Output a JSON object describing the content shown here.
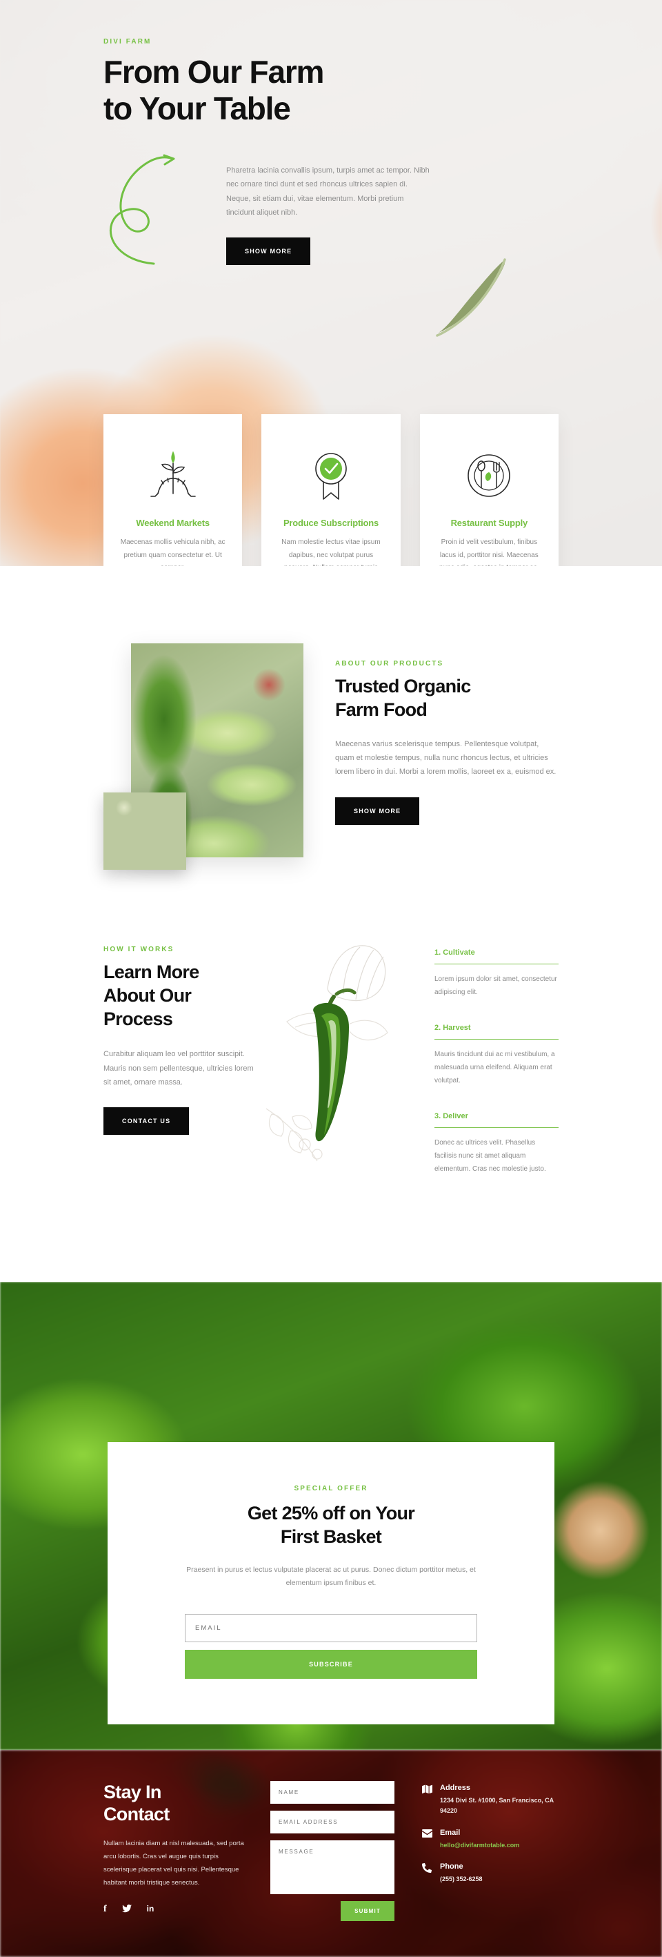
{
  "hero": {
    "eyebrow": "DIVI FARM",
    "title_line1": "From Our Farm",
    "title_line2": "to Your Table",
    "paragraph": "Pharetra lacinia convallis ipsum, turpis amet ac tempor. Nibh nec ornare tinci dunt et sed rhoncus ultrices sapien di. Neque, sit etiam dui, vitae elementum. Morbi pretium tincidunt aliquet nibh.",
    "cta_label": "SHOW MORE"
  },
  "cards": [
    {
      "icon": "seedling-icon",
      "title": "Weekend Markets",
      "text": "Maecenas mollis vehicula nibh, ac pretium quam consectetur et. Ut semper."
    },
    {
      "icon": "award-badge-icon",
      "title": "Produce Subscriptions",
      "text": "Nam molestie lectus vitae ipsum dapibus, nec volutpat purus posuere. Nullam semper turpis"
    },
    {
      "icon": "plate-cutlery-icon",
      "title": "Restaurant Supply",
      "text": "Proin id velit vestibulum, finibus lacus id, porttitor nisi. Maecenas nunc odio, egestas in tempor ac."
    }
  ],
  "about": {
    "eyebrow": "ABOUT OUR PRODUCTS",
    "title_line1": "Trusted Organic",
    "title_line2": "Farm Food",
    "paragraph": "Maecenas varius scelerisque tempus. Pellentesque volutpat, quam et molestie tempus, nulla nunc rhoncus lectus, et ultricies lorem libero in dui. Morbi a lorem mollis, laoreet ex a, euismod ex.",
    "cta_label": "SHOW MORE"
  },
  "process": {
    "eyebrow": "HOW IT WORKS",
    "title_line1": "Learn More",
    "title_line2": "About Our",
    "title_line3": "Process",
    "paragraph": "Curabitur aliquam leo vel porttitor suscipit. Mauris non sem pellentesque, ultricies lorem sit amet, ornare massa.",
    "cta_label": "CONTACT US",
    "steps": [
      {
        "title": "1. Cultivate",
        "text": "Lorem ipsum dolor sit amet, consectetur adipiscing elit."
      },
      {
        "title": "2. Harvest",
        "text": "Mauris tincidunt dui ac mi vestibulum, a malesuada urna eleifend. Aliquam erat volutpat."
      },
      {
        "title": "3. Deliver",
        "text": "Donec ac ultrices velit. Phasellus facilisis nunc sit amet aliquam elementum. Cras nec molestie justo."
      }
    ]
  },
  "offer": {
    "eyebrow": "SPECIAL OFFER",
    "title_line1": "Get 25% off on Your",
    "title_line2": "First Basket",
    "paragraph": "Praesent in purus et lectus vulputate placerat ac ut purus. Donec dictum porttitor metus, et elementum ipsum finibus et.",
    "email_placeholder": "EMAIL",
    "email_value": "",
    "subscribe_label": "SUBSCRIBE"
  },
  "footer": {
    "title_line1": "Stay In",
    "title_line2": "Contact",
    "paragraph": "Nullam lacinia diam at nisl malesuada, sed porta arcu lobortis. Cras vel augue quis turpis scelerisque placerat vel quis nisi. Pellentesque habitant morbi tristique senectus.",
    "socials": [
      {
        "name": "facebook-icon",
        "glyph": "f"
      },
      {
        "name": "twitter-icon",
        "glyph": "ᵥ"
      },
      {
        "name": "linkedin-icon",
        "glyph": "in"
      }
    ],
    "form": {
      "name_placeholder": "NAME",
      "name_value": "",
      "email_placeholder": "EMAIL ADDRESS",
      "email_value": "",
      "message_placeholder": "MESSAGE",
      "message_value": "",
      "submit_label": "SUBMIT"
    },
    "contacts": [
      {
        "icon": "map-icon",
        "title": "Address",
        "value": "1234 Divi St. #1000, San Francisco, CA 94220",
        "accent": false
      },
      {
        "icon": "envelope-icon",
        "title": "Email",
        "value": "hello@divifarmtotable.com",
        "accent": true
      },
      {
        "icon": "phone-icon",
        "title": "Phone",
        "value": "(255) 352-6258",
        "accent": false
      }
    ]
  },
  "colors": {
    "green": "#76c043",
    "dark": "#0b0b0b",
    "muted": "#8b8b8b"
  }
}
